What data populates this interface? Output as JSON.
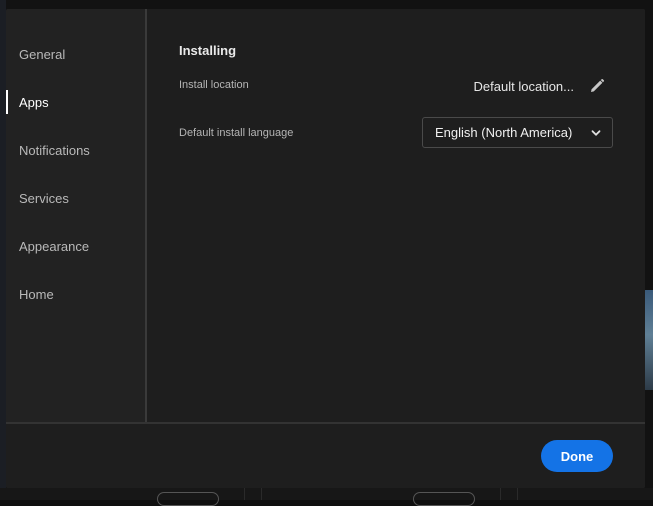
{
  "sidebar": {
    "items": [
      {
        "label": "General",
        "active": false
      },
      {
        "label": "Apps",
        "active": true
      },
      {
        "label": "Notifications",
        "active": false
      },
      {
        "label": "Services",
        "active": false
      },
      {
        "label": "Appearance",
        "active": false
      },
      {
        "label": "Home",
        "active": false
      }
    ]
  },
  "main": {
    "section_title": "Installing",
    "install_location": {
      "label": "Install location",
      "value": "Default location...",
      "edit_icon": "pencil-icon"
    },
    "install_language": {
      "label": "Default install language",
      "selected": "English (North America)",
      "dropdown_icon": "chevron-down-icon"
    }
  },
  "footer": {
    "done_label": "Done"
  },
  "colors": {
    "accent": "#1473e6",
    "dialog_bg": "#1e1e1e",
    "sidebar_bg": "#222222"
  }
}
